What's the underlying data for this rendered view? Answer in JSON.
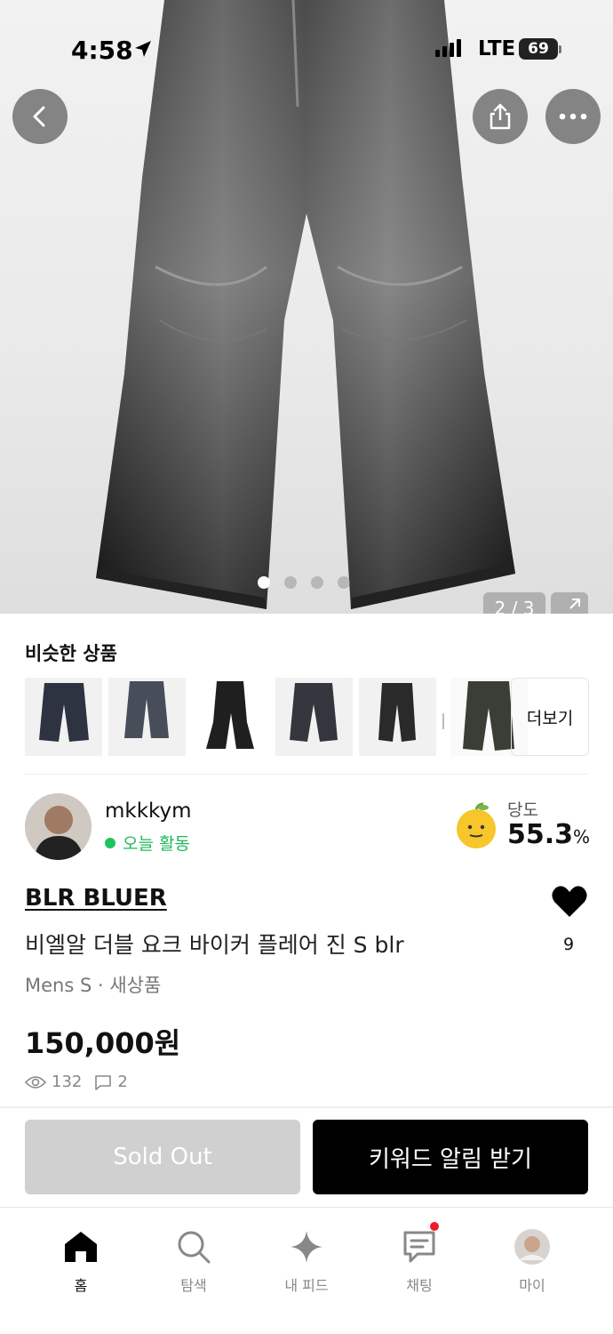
{
  "status_bar": {
    "time": "4:58",
    "network": "LTE",
    "battery": "69"
  },
  "hero": {
    "image_counter": "2 / 3",
    "dots_count": 4,
    "active_dot": 1
  },
  "similar": {
    "title": "비슷한 상품",
    "more_label": "더보기",
    "thumbnail_count": 6
  },
  "seller": {
    "name": "mkkkym",
    "activity": "오늘 활동",
    "sweetness_label": "당도",
    "sweetness_value": "55.3",
    "sweetness_unit": "%"
  },
  "product": {
    "brand": "BLR BLUER",
    "title": "비엘알 더블 요크 바이커 플레어 진 S blr",
    "meta": "Mens S · 새상품",
    "price": "150,000원",
    "views": "132",
    "comments": "2",
    "likes": "9"
  },
  "actions": {
    "sold_out_label": "Sold Out",
    "keyword_alert_label": "키워드 알림 받기"
  },
  "tabbar": {
    "items": [
      {
        "label": "홈",
        "icon": "home-icon",
        "active": true
      },
      {
        "label": "탐색",
        "icon": "search-icon",
        "active": false
      },
      {
        "label": "내 피드",
        "icon": "sparkle-icon",
        "active": false
      },
      {
        "label": "채팅",
        "icon": "chat-icon",
        "active": false,
        "badge": true
      },
      {
        "label": "마이",
        "icon": "profile-avatar",
        "active": false
      }
    ]
  },
  "colors": {
    "accent_green": "#1fb85a",
    "badge_red": "#f31a2a",
    "primary_black": "#000000",
    "disabled_gray": "#d0d0d0"
  }
}
